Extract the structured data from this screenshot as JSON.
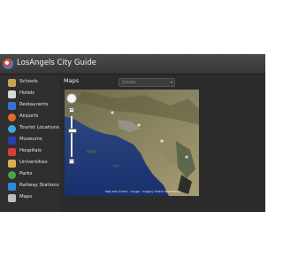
{
  "app": {
    "title": "LosAngels City Guide"
  },
  "sidebar": {
    "items": [
      {
        "label": "Schools",
        "icon": "school-icon",
        "color": "#c8a24a"
      },
      {
        "label": "Hotels",
        "icon": "hotel-icon",
        "color": "#d9d9d9"
      },
      {
        "label": "Restaurants",
        "icon": "restaurant-icon",
        "color": "#3b6fd8"
      },
      {
        "label": "Airports",
        "icon": "airplane-icon",
        "color": "#e26b2b"
      },
      {
        "label": "Tourist Locations",
        "icon": "camera-icon",
        "color": "#3fa7d8"
      },
      {
        "label": "Museums",
        "icon": "museum-icon",
        "color": "#2d3fa8"
      },
      {
        "label": "Hospitals",
        "icon": "hospital-icon",
        "color": "#d83b3b"
      },
      {
        "label": "Universities",
        "icon": "university-icon",
        "color": "#d8b04a"
      },
      {
        "label": "Parks",
        "icon": "park-icon",
        "color": "#48a844"
      },
      {
        "label": "Railway Stations",
        "icon": "train-icon",
        "color": "#2f8ad8"
      },
      {
        "label": "Maps",
        "icon": "map-icon",
        "color": "#bdbdbd"
      }
    ]
  },
  "main": {
    "title": "Maps",
    "dropdown": {
      "selected": "Schools"
    },
    "map": {
      "attribution": "Map data ©2011 · Google · Imagery ©2011 TerraMetrics"
    }
  }
}
